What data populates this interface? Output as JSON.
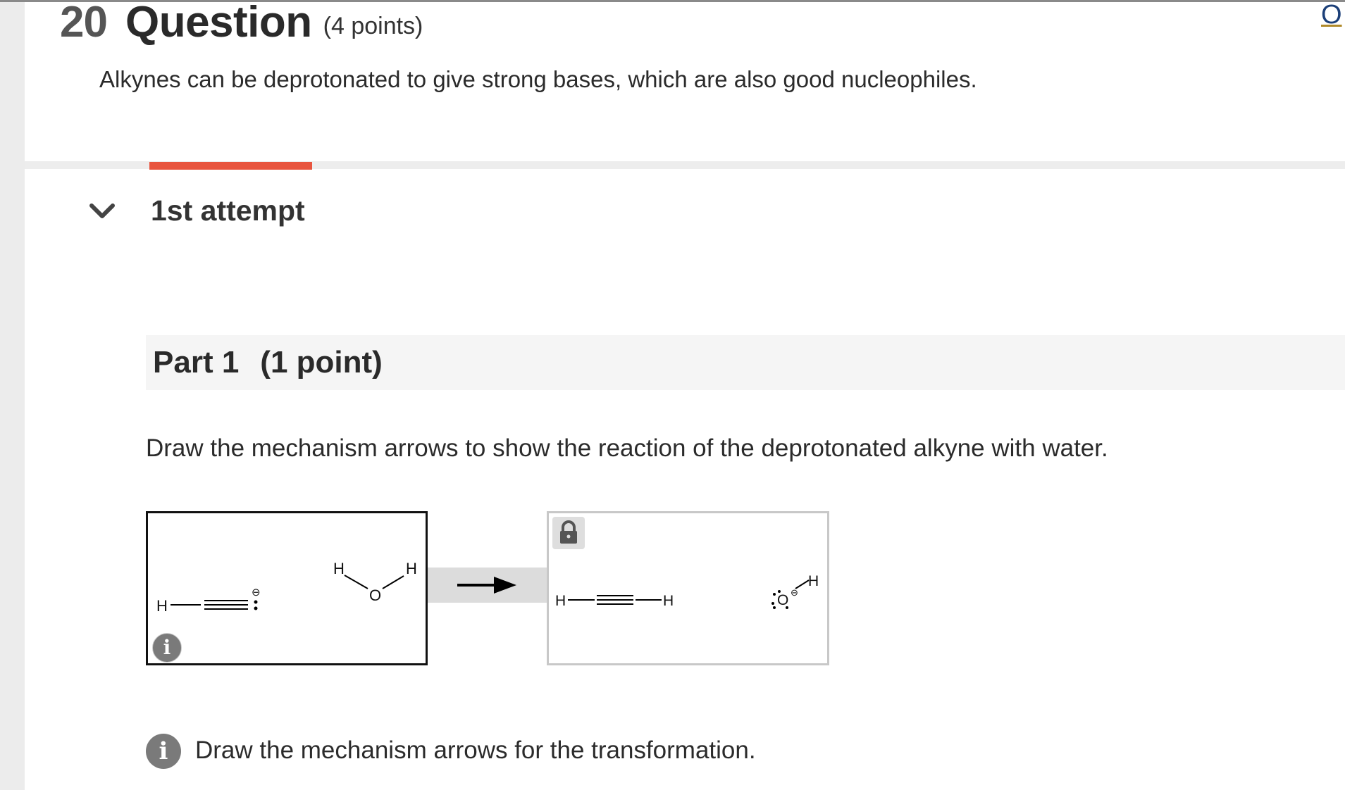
{
  "question": {
    "number": "20",
    "title": "Question",
    "points": "(4 points)",
    "intro": "Alkynes can be deprotonated to give strong bases, which are also good nucleophiles."
  },
  "top_right_link": "O",
  "attempt": {
    "label": "1st attempt",
    "chevron_icon": "chevron-down-icon"
  },
  "part": {
    "label": "Part 1",
    "points": "(1 point)",
    "prompt": "Draw the mechanism arrows to show the reaction of the deprotonated alkyne with water."
  },
  "reactants": {
    "alkyne_h": "H",
    "water_h_left": "H",
    "water_o": "O",
    "water_h_right": "H",
    "charge_symbol": "⊖",
    "info_icon": "info-icon"
  },
  "products": {
    "alkyne_h_left": "H",
    "alkyne_h_right": "H",
    "hydroxide_o": "O",
    "hydroxide_h": "H",
    "charge_symbol": "⊖",
    "lock_icon": "lock-icon"
  },
  "footer": {
    "info_icon": "info-icon",
    "hint": "Draw the mechanism arrows for the transformation."
  },
  "colors": {
    "accent_progress": "#e8553f",
    "link": "#1c3f78",
    "link_underline": "#b08a2a",
    "info_badge": "#7a7a7a"
  }
}
